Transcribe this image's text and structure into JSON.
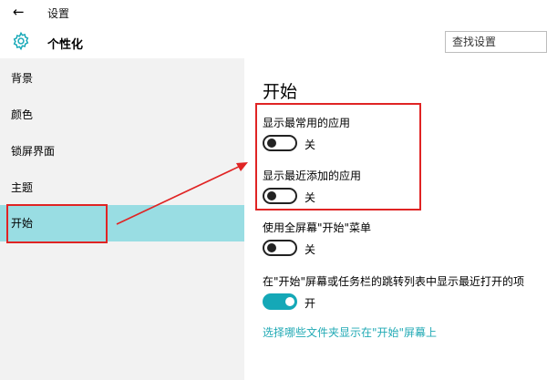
{
  "window": {
    "title": "设置"
  },
  "header": {
    "title": "个性化",
    "search_placeholder": "查找设置"
  },
  "sidebar": {
    "items": [
      {
        "label": "背景"
      },
      {
        "label": "颜色"
      },
      {
        "label": "锁屏界面"
      },
      {
        "label": "主题"
      },
      {
        "label": "开始",
        "active": true
      }
    ]
  },
  "main": {
    "heading": "开始",
    "settings": [
      {
        "label": "显示最常用的应用",
        "state": "关",
        "on": false
      },
      {
        "label": "显示最近添加的应用",
        "state": "关",
        "on": false
      },
      {
        "label": "使用全屏幕\"开始\"菜单",
        "state": "关",
        "on": false
      },
      {
        "label": "在\"开始\"屏幕或任务栏的跳转列表中显示最近打开的项",
        "state": "开",
        "on": true
      }
    ],
    "link": "选择哪些文件夹显示在\"开始\"屏幕上"
  },
  "colors": {
    "accent": "#15a8b7",
    "active_item": "#99dde3",
    "annotation": "#e02424"
  },
  "icons": [
    "back-arrow-icon",
    "gear-icon"
  ]
}
